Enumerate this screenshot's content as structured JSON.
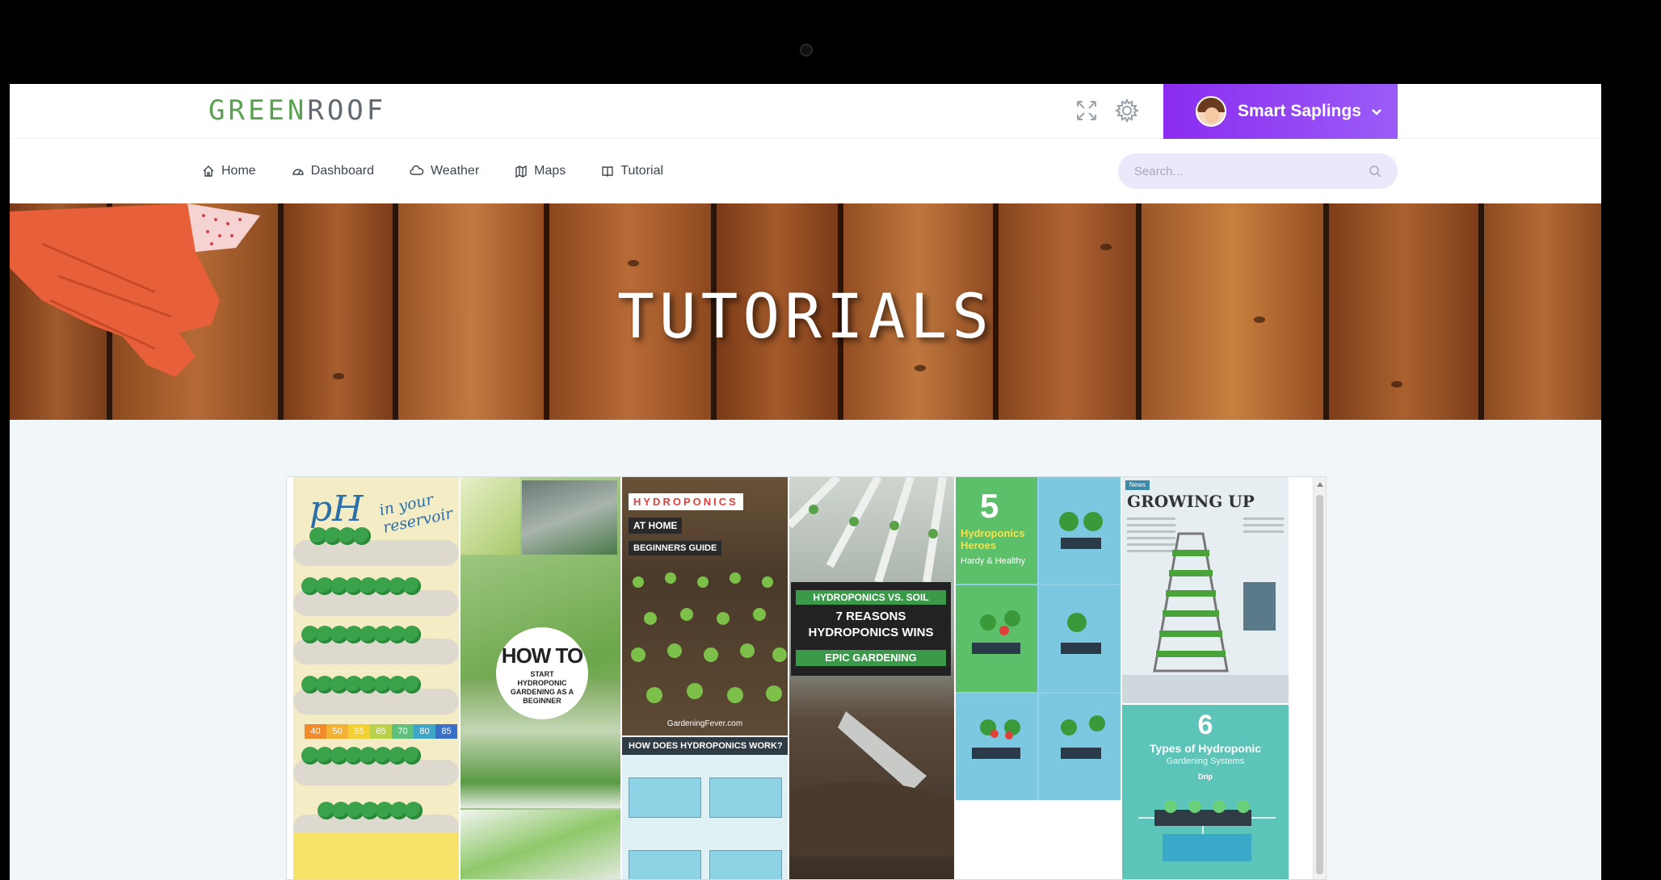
{
  "brand": {
    "part1": "GREEN",
    "part2": "ROOF"
  },
  "header": {
    "icons": [
      "fullscreen-icon",
      "gear-icon"
    ],
    "user": {
      "name": "Smart Saplings",
      "caret": "⌄"
    }
  },
  "nav": {
    "items": [
      {
        "label": "Home",
        "icon": "home-icon"
      },
      {
        "label": "Dashboard",
        "icon": "dashboard-icon"
      },
      {
        "label": "Weather",
        "icon": "cloud-icon"
      },
      {
        "label": "Maps",
        "icon": "map-icon"
      },
      {
        "label": "Tutorial",
        "icon": "book-icon"
      }
    ],
    "search_placeholder": "Search..."
  },
  "banner": {
    "title": "TUTORIALS"
  },
  "gallery": {
    "ph": {
      "title": "pH",
      "subtitle": "in your reservoir",
      "scale": [
        "40",
        "50",
        "55",
        "65",
        "70",
        "80",
        "85"
      ]
    },
    "howto": {
      "big": "HOW TO",
      "lines": "START HYDROPONIC GARDENING AS A BEGINNER"
    },
    "home": {
      "l1": "HYDROPONICS",
      "l2": "AT HOME",
      "l3": "BEGINNERS GUIDE",
      "site": "GardeningFever.com",
      "works": "HOW DOES HYDROPONICS WORK?"
    },
    "epic": {
      "l1": "HYDROPONICS VS. SOIL",
      "l2": "7 REASONS",
      "l3": "HYDROPONICS WINS",
      "l4": "EPIC GARDENING"
    },
    "heroes": {
      "num": "5",
      "title": "Hydroponics Heroes",
      "sub": "Hardy & Healthy"
    },
    "growing": {
      "tag": "News",
      "title": "GROWING UP"
    },
    "types": {
      "num": "6",
      "title": "Types of Hydroponic",
      "sub": "Gardening Systems",
      "drip": "Drip"
    }
  },
  "colors": {
    "accent": "#8a2cf0",
    "brand_green": "#5aa24f",
    "brand_gray": "#606a70"
  }
}
